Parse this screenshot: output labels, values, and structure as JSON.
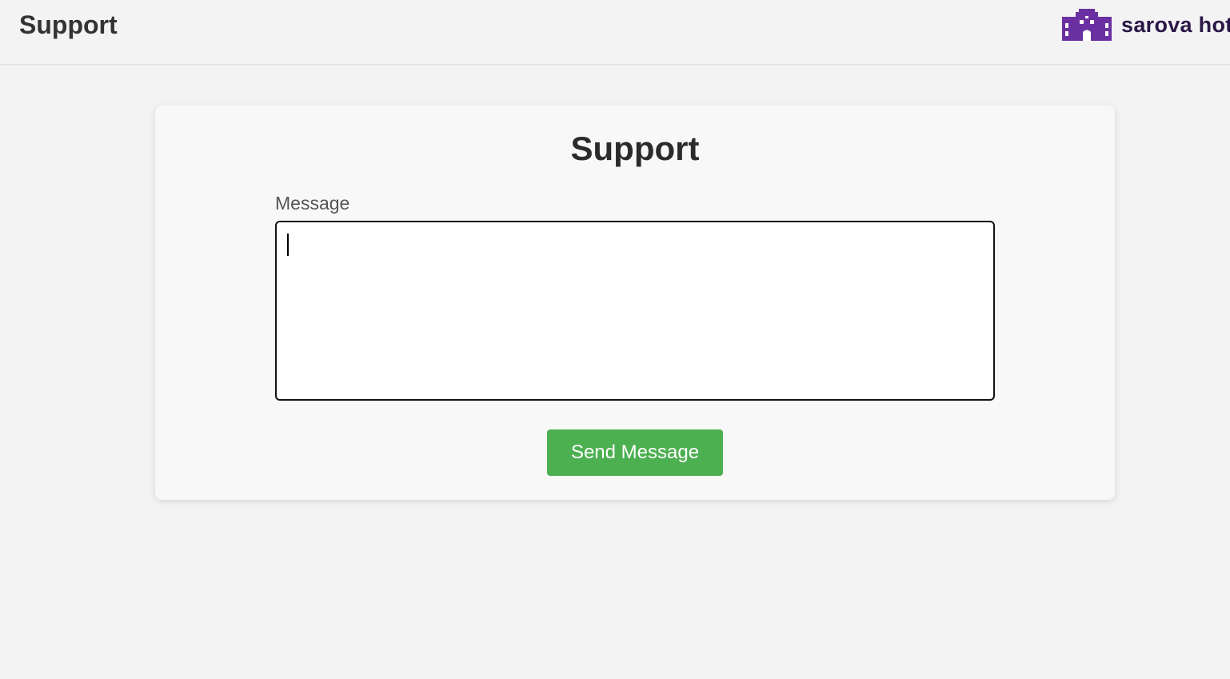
{
  "header": {
    "title": "Support",
    "brand_name": "sarova hot",
    "brand_logo_icon": "hotel-building-icon",
    "brand_color": "#6a2fa0"
  },
  "form": {
    "title": "Support",
    "message_label": "Message",
    "message_value": "",
    "message_placeholder": "",
    "send_label": "Send Message",
    "send_color": "#4caf50"
  }
}
